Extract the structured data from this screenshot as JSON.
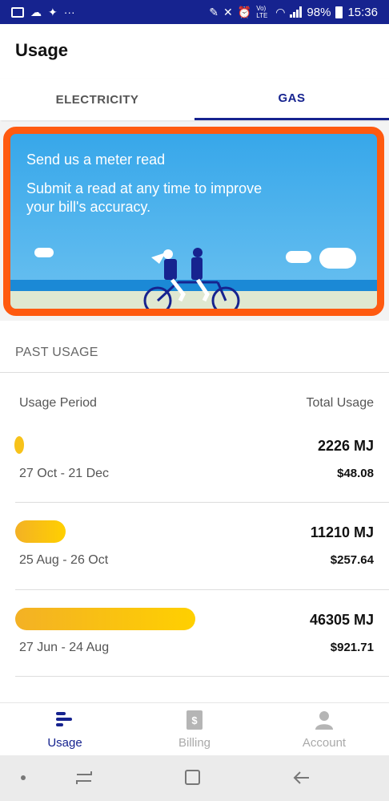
{
  "status_bar": {
    "battery": "98%",
    "time": "15:36",
    "dots": "···",
    "lte": "Vo) LTE"
  },
  "header": {
    "title": "Usage"
  },
  "tabs": [
    {
      "label": "ELECTRICITY",
      "active": false
    },
    {
      "label": "GAS",
      "active": true
    }
  ],
  "banner": {
    "heading": "Send us a meter read",
    "body": "Submit a read at any time to improve your bill's accuracy."
  },
  "past_usage": {
    "section_title": "PAST USAGE",
    "columns": {
      "period": "Usage Period",
      "total": "Total Usage"
    },
    "rows": [
      {
        "period": "27 Oct - 21 Dec",
        "usage": "2226 MJ",
        "cost": "$48.08",
        "bar_fraction": 0.05
      },
      {
        "period": "25 Aug - 26 Oct",
        "usage": "11210 MJ",
        "cost": "$257.64",
        "bar_fraction": 0.27
      },
      {
        "period": "27 Jun - 24 Aug",
        "usage": "46305 MJ",
        "cost": "$921.71",
        "bar_fraction": 1.0
      }
    ]
  },
  "bottom_nav": [
    {
      "label": "Usage",
      "icon": "usage-bars-icon",
      "active": true
    },
    {
      "label": "Billing",
      "icon": "dollar-document-icon",
      "active": false
    },
    {
      "label": "Account",
      "icon": "person-icon",
      "active": false
    }
  ],
  "colors": {
    "brand": "#16238f",
    "highlight": "#ff5a10",
    "bar_start": "#f3b125",
    "bar_end": "#ffd000"
  }
}
